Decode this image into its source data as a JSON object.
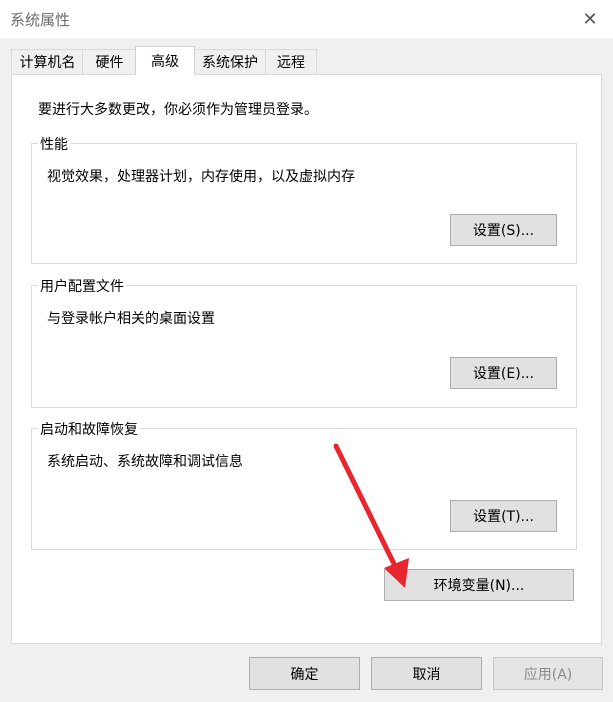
{
  "window": {
    "title": "系统属性",
    "close_icon": "close-icon"
  },
  "tabs": [
    {
      "label": "计算机名",
      "active": false
    },
    {
      "label": "硬件",
      "active": false
    },
    {
      "label": "高级",
      "active": true
    },
    {
      "label": "系统保护",
      "active": false
    },
    {
      "label": "远程",
      "active": false
    }
  ],
  "advanced": {
    "admin_note": "要进行大多数更改，你必须作为管理员登录。",
    "performance": {
      "label": "性能",
      "description": "视觉效果，处理器计划，内存使用，以及虚拟内存",
      "button": "设置(S)..."
    },
    "user_profiles": {
      "label": "用户配置文件",
      "description": "与登录帐户相关的桌面设置",
      "button": "设置(E)..."
    },
    "startup_recovery": {
      "label": "启动和故障恢复",
      "description": "系统启动、系统故障和调试信息",
      "button": "设置(T)..."
    },
    "env_button": "环境变量(N)..."
  },
  "footer": {
    "ok": "确定",
    "cancel": "取消",
    "apply": "应用(A)",
    "apply_enabled": false
  },
  "annotation": {
    "arrow_color": "#e8262f"
  }
}
